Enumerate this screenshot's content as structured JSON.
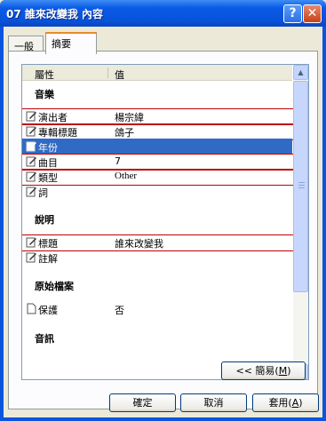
{
  "window": {
    "title": "07 誰來改變我 內容",
    "help_glyph": "?",
    "close_glyph": "✕"
  },
  "tabs": [
    {
      "label": "一般"
    },
    {
      "label": "摘要"
    }
  ],
  "columns": {
    "property": "屬性",
    "value": "值"
  },
  "groups": {
    "music": "音樂",
    "description": "說明",
    "origin": "原始檔案",
    "audio": "音訊"
  },
  "rows": {
    "artist": {
      "label": "演出者",
      "value": "楊宗緯",
      "icon": "edit-icon"
    },
    "album": {
      "label": "專輯標題",
      "value": "鴿子",
      "icon": "edit-icon"
    },
    "year": {
      "label": "年份",
      "value": "",
      "icon": "edit-icon"
    },
    "track": {
      "label": "曲目",
      "value": "7",
      "icon": "edit-icon"
    },
    "genre": {
      "label": "類型",
      "value": "Other",
      "icon": "edit-icon"
    },
    "lyrics": {
      "label": "詞",
      "value": "",
      "icon": "edit-icon"
    },
    "title": {
      "label": "標題",
      "value": "誰來改變我",
      "icon": "edit-icon"
    },
    "comment": {
      "label": "註解",
      "value": "",
      "icon": "edit-icon"
    },
    "protected": {
      "label": "保護",
      "value": "否",
      "icon": "page-icon"
    }
  },
  "buttons": {
    "simple_prefix": "<< 簡易(",
    "simple_key": "M",
    "simple_suffix": ")",
    "ok": "確定",
    "cancel": "取消",
    "apply_prefix": "套用(",
    "apply_key": "A",
    "apply_suffix": ")"
  },
  "colors": {
    "selection": "#316ac5",
    "highlight_box": "#c00000",
    "titlebar": "#0a5ae6"
  }
}
